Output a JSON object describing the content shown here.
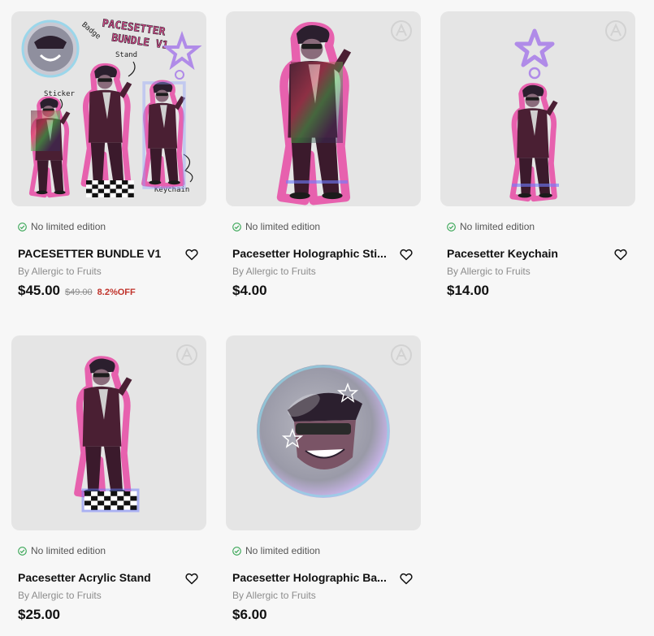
{
  "products": [
    {
      "limited": "No limited edition",
      "title": "PACESETTER BUNDLE V1",
      "by": "By Allergic to Fruits",
      "price": "$45.00",
      "old_price": "$49.00",
      "discount": "8.2%OFF",
      "image_labels": {
        "title_line1": "PACESETTER",
        "title_line2": "BUNDLE V1",
        "badge": "Badge",
        "stand": "Stand",
        "sticker": "Sticker",
        "keychain": "Keychain"
      }
    },
    {
      "limited": "No limited edition",
      "title": "Pacesetter Holographic Sti...",
      "by": "By Allergic to Fruits",
      "price": "$4.00"
    },
    {
      "limited": "No limited edition",
      "title": "Pacesetter Keychain",
      "by": "By Allergic to Fruits",
      "price": "$14.00"
    },
    {
      "limited": "No limited edition",
      "title": "Pacesetter Acrylic Stand",
      "by": "By Allergic to Fruits",
      "price": "$25.00"
    },
    {
      "limited": "No limited edition",
      "title": "Pacesetter Holographic Ba...",
      "by": "By Allergic to Fruits",
      "price": "$6.00"
    }
  ],
  "colors": {
    "accent_discount": "#c0332b",
    "check_green": "#3aa757",
    "thumb_bg": "#e5e5e5"
  },
  "icons": {
    "limited": "check-circle-icon",
    "wishlist": "heart-outline-icon",
    "watermark": "brand-watermark-icon"
  }
}
